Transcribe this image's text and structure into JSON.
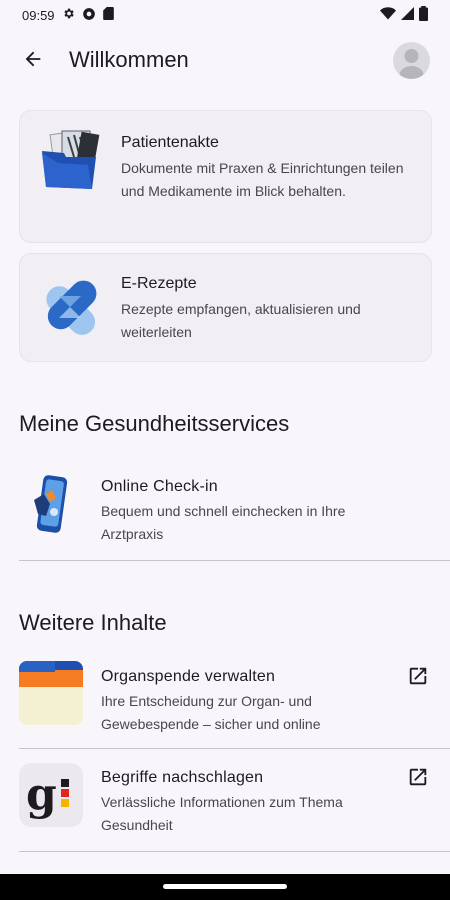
{
  "status": {
    "time": "09:59"
  },
  "header": {
    "title": "Willkommen"
  },
  "cards": [
    {
      "title": "Patientenakte",
      "description": "Dokumente mit Praxen & Einrichtungen teilen und Medikamente im Blick behalten."
    },
    {
      "title": "E-Rezepte",
      "description": "Rezepte empfangen, aktualisieren und weiterleiten"
    }
  ],
  "services": {
    "heading": "Meine Gesundheitsservices",
    "items": [
      {
        "title": "Online Check-in",
        "description": "Bequem und schnell einchecken in Ihre Arztpraxis"
      }
    ]
  },
  "more": {
    "heading": "Weitere Inhalte",
    "items": [
      {
        "title": "Organspende verwalten",
        "description": "Ihre Entscheidung zur Organ- und Gewebespende – sicher und online"
      },
      {
        "title": "Begriffe nachschlagen",
        "description": "Verlässliche Informationen zum Thema Gesundheit"
      }
    ]
  },
  "colors": {
    "background": "#f8f6fb",
    "card": "#f1eff4",
    "blue_dark": "#1f4fb0",
    "blue_light": "#9ec5ef",
    "orange": "#f57c22",
    "divider": "#cac4d0"
  },
  "icons": [
    "settings-icon",
    "vpn-icon",
    "sd-card-icon",
    "wifi-icon",
    "signal-icon",
    "battery-icon",
    "arrow-back-icon",
    "open-in-new-icon"
  ]
}
